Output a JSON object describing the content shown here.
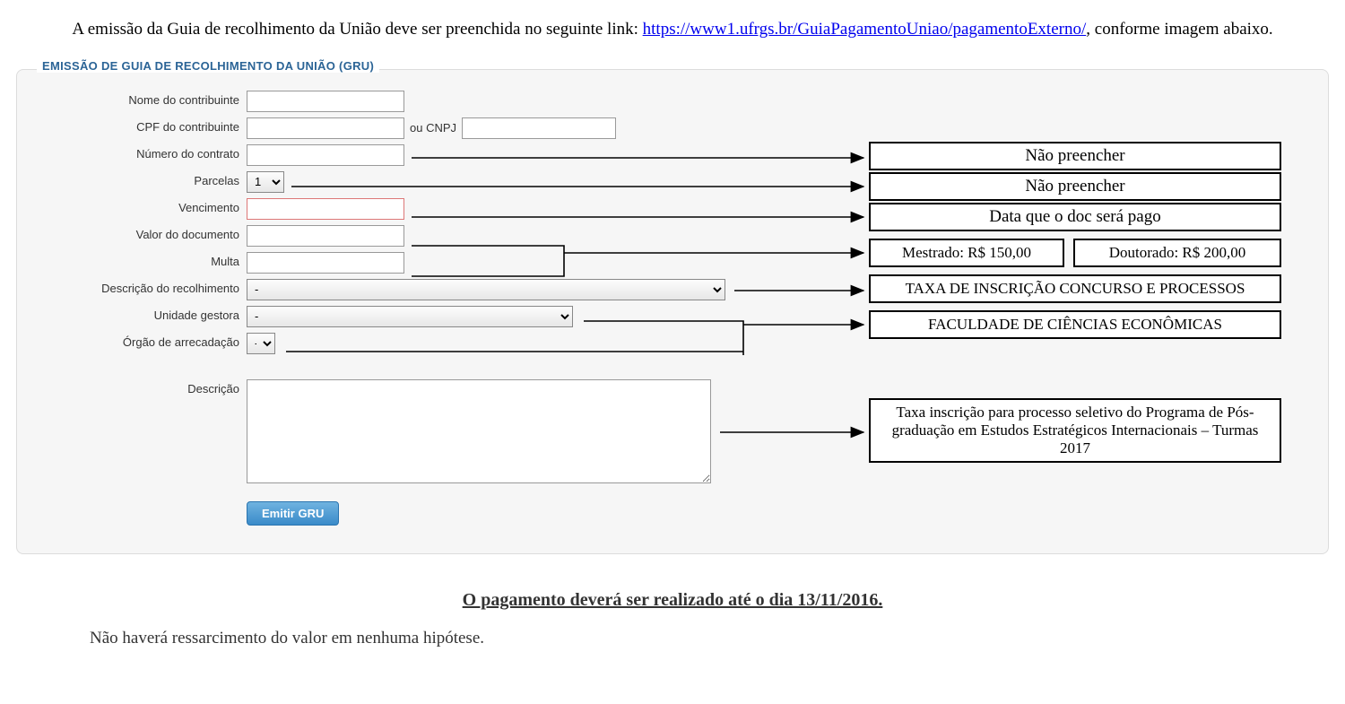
{
  "intro": {
    "before": "A emissão da Guia de recolhimento da União deve ser preenchida no seguinte link: ",
    "url": "https://www1.ufrgs.br/GuiaPagamentoUniao/pagamentoExterno/",
    "after": ", conforme imagem abaixo."
  },
  "panel": {
    "legend": "EMISSÃO DE GUIA DE RECOLHIMENTO DA UNIÃO (GRU)"
  },
  "form": {
    "nome": {
      "label": "Nome do contribuinte",
      "value": ""
    },
    "cpf": {
      "label": "CPF do contribuinte",
      "value": "",
      "or": "ou CNPJ",
      "cnpj": ""
    },
    "contrato": {
      "label": "Número do contrato",
      "value": ""
    },
    "parcelas": {
      "label": "Parcelas",
      "value": "1"
    },
    "vencimento": {
      "label": "Vencimento",
      "value": ""
    },
    "valor": {
      "label": "Valor do documento",
      "value": ""
    },
    "multa": {
      "label": "Multa",
      "value": ""
    },
    "desc_rec": {
      "label": "Descrição do recolhimento",
      "value": "-"
    },
    "unidade": {
      "label": "Unidade gestora",
      "value": "-"
    },
    "orgao": {
      "label": "Órgão de arrecadação",
      "value": "-"
    },
    "descricao": {
      "label": "Descrição",
      "value": ""
    },
    "submit": "Emitir GRU"
  },
  "annotations": {
    "contrato": "Não preencher",
    "parcelas": "Não preencher",
    "vencimento": "Data que o doc será pago",
    "valor_mestrado": "Mestrado: R$ 150,00",
    "valor_doutorado": "Doutorado: R$ 200,00",
    "desc_rec": "TAXA DE INSCRIÇÃO CONCURSO E PROCESSOS",
    "unidade": "FACULDADE DE CIÊNCIAS ECONÔMICAS",
    "descricao": "Taxa inscrição para processo seletivo do Programa de Pós-graduação em Estudos Estratégicos Internacionais – Turmas 2017"
  },
  "deadline": "O pagamento deverá ser realizado até o dia 13/11/2016.",
  "footer": "Não haverá ressarcimento do valor em nenhuma hipótese."
}
